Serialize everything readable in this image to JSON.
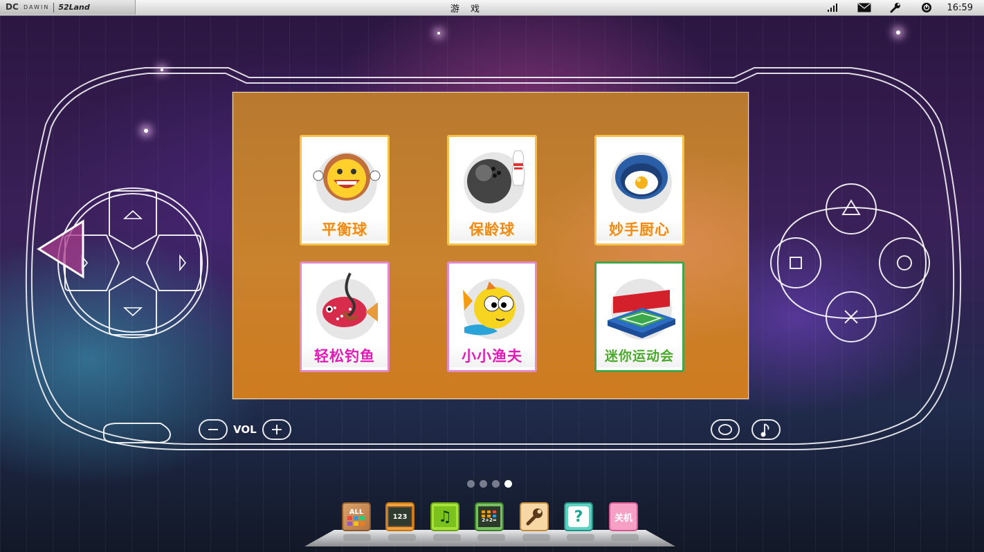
{
  "topbar": {
    "logo_brand": "DAWIN",
    "logo_product": "52Land",
    "title": "游 戏",
    "clock": "16:59",
    "icons": [
      "signal-icon",
      "mail-icon",
      "wrench-icon",
      "power-icon"
    ]
  },
  "games": [
    {
      "name": "平衡球",
      "icon": "smiley-ball-icon",
      "style": "orange"
    },
    {
      "name": "保龄球",
      "icon": "bowling-icon",
      "style": "orange"
    },
    {
      "name": "妙手厨心",
      "icon": "fried-egg-pan-icon",
      "style": "orange"
    },
    {
      "name": "轻松钓鱼",
      "icon": "pufferfish-hook-icon",
      "style": "pink"
    },
    {
      "name": "小小渔夫",
      "icon": "yellow-fish-icon",
      "style": "pink"
    },
    {
      "name": "迷你运动会",
      "icon": "sports-field-icon",
      "style": "green"
    }
  ],
  "console": {
    "vol_label": "VOL",
    "vol_minus": "−",
    "vol_plus": "+"
  },
  "pager": {
    "total": 4,
    "current": 4
  },
  "dock": [
    {
      "label": "ALL",
      "icon": "all-apps-icon"
    },
    {
      "label": "123",
      "icon": "chalkboard-icon"
    },
    {
      "label": "♫",
      "icon": "music-icon"
    },
    {
      "label": "2+2=",
      "icon": "calculator-icon"
    },
    {
      "label": "",
      "icon": "wrench-settings-icon"
    },
    {
      "label": "?",
      "icon": "help-icon"
    },
    {
      "label": "关机",
      "icon": "shutdown-icon"
    }
  ]
}
